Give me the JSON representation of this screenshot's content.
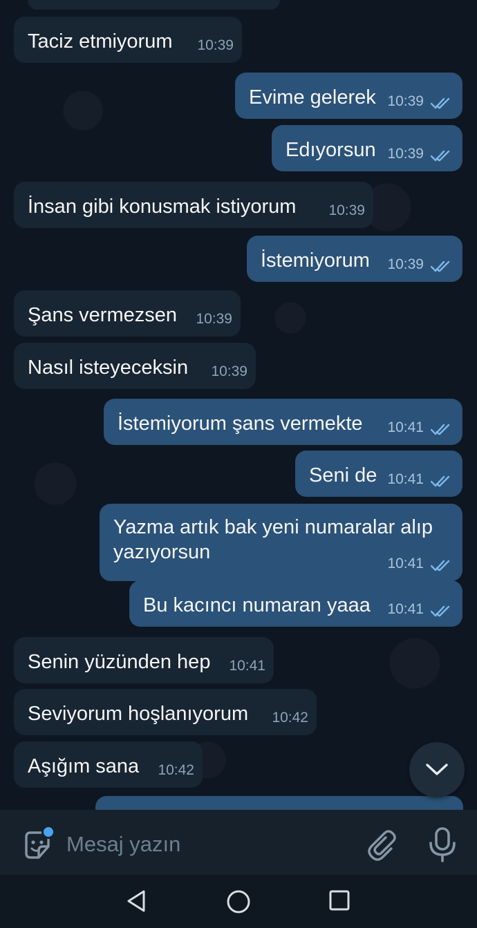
{
  "messages": [
    {
      "dir": "in",
      "text": "Taciz etmiyorum",
      "time": "10:39"
    },
    {
      "dir": "out",
      "text": "Evime gelerek",
      "time": "10:39"
    },
    {
      "dir": "out",
      "text": "Edıyorsun",
      "time": "10:39"
    },
    {
      "dir": "in",
      "text": "İnsan gibi konusmak istiyorum",
      "time": "10:39"
    },
    {
      "dir": "out",
      "text": "İstemiyorum",
      "time": "10:39"
    },
    {
      "dir": "in",
      "text": "Şans vermezsen",
      "time": "10:39"
    },
    {
      "dir": "in",
      "text": "Nasıl isteyeceksin",
      "time": "10:39"
    },
    {
      "dir": "out",
      "text": "İstemiyorum şans vermekte",
      "time": "10:41"
    },
    {
      "dir": "out",
      "text": "Seni de",
      "time": "10:41"
    },
    {
      "dir": "out",
      "text": "Yazma artık bak yeni numaralar alıp yazıyorsun",
      "time": "10:41"
    },
    {
      "dir": "out",
      "text": "Bu kacıncı numaran yaaa",
      "time": "10:41"
    },
    {
      "dir": "in",
      "text": "Senin yüzünden hep",
      "time": "10:41"
    },
    {
      "dir": "in",
      "text": "Seviyorum hoşlanıyorum",
      "time": "10:42"
    },
    {
      "dir": "in",
      "text": "Aşığım sana",
      "time": "10:42"
    }
  ],
  "composer": {
    "placeholder": "Mesaj yazın",
    "emoji_icon": "sticker-emoji-icon",
    "attach_icon": "paperclip-icon",
    "mic_icon": "microphone-icon"
  },
  "navigation": {
    "back_icon": "back-triangle-icon",
    "home_icon": "home-circle-icon",
    "recents_icon": "recents-square-icon"
  },
  "colors": {
    "background": "#0e1621",
    "incoming_bubble": "#182533",
    "outgoing_bubble": "#2b5278",
    "read_check": "#7db8ec",
    "accent": "#4aa3f0"
  }
}
